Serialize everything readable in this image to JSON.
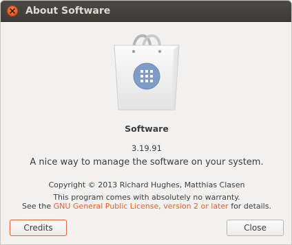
{
  "window": {
    "title": "About Software"
  },
  "icons": {
    "close": "close-icon",
    "app_logo": "shopping-bag-icon",
    "apps_grid": "app-grid-icon"
  },
  "colors": {
    "titlebar": "#3c3b37",
    "close_button": "#e6531c",
    "accent": "#e2622b",
    "logo_badge": "#7e9cc8"
  },
  "about": {
    "name": "Software",
    "version": "3.19.91",
    "comments": "A nice way to manage the software on your system.",
    "copyright": "Copyright © 2013 Richard Hughes, Matthias Clasen",
    "license_line1": "This program comes with absolutely no warranty.",
    "license_prefix": "See the ",
    "license_link": "GNU General Public License, version 2 or later",
    "license_suffix": " for details."
  },
  "buttons": {
    "credits": "Credits",
    "close": "Close"
  }
}
